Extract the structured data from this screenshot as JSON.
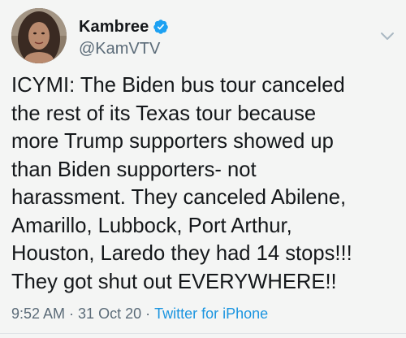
{
  "author": {
    "display_name": "Kambree",
    "handle": "@KamVTV",
    "verified": true
  },
  "tweet": {
    "text": "ICYMI: The Biden bus tour canceled\nthe rest of its Texas tour because\nmore Trump supporters showed up\nthan Biden supporters- not\nharassment. They canceled Abilene,\nAmarillo, Lubbock, Port Arthur,\nHouston, Laredo they had 14 stops!!!\nThey got shut out EVERYWHERE!!"
  },
  "meta": {
    "time": "9:52 AM",
    "separator": "·",
    "date": "31 Oct 20",
    "source": "Twitter for iPhone"
  },
  "icons": {
    "verified": "verified-badge-icon",
    "menu": "chevron-down-icon"
  },
  "colors": {
    "accent": "#1b95e0",
    "muted": "#5b6b78",
    "text": "#14171a",
    "background": "#f4f5f4"
  }
}
